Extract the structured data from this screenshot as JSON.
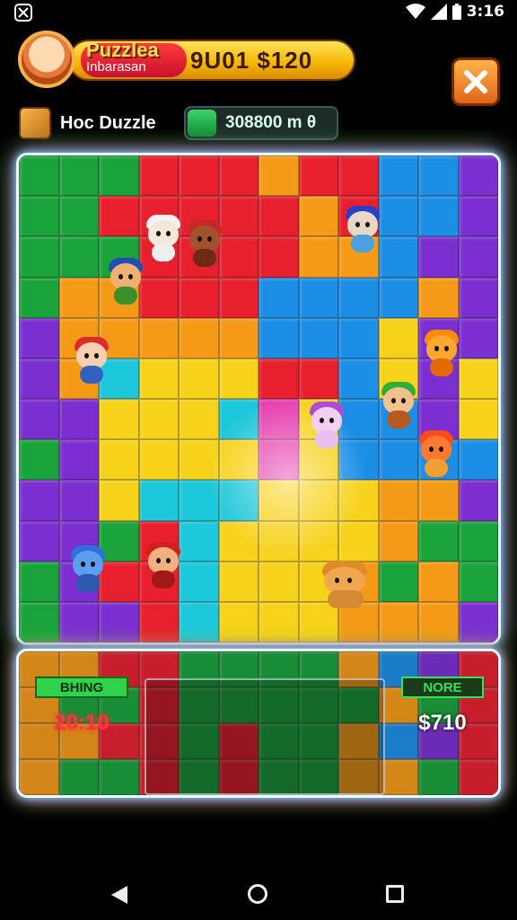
{
  "status_bar": {
    "time": "3:16",
    "icons": [
      "app-notification-icon",
      "wifi-icon",
      "signal-icon",
      "battery-icon"
    ]
  },
  "header": {
    "title": "Puzzlea",
    "subtitle": "Inbarasan",
    "score": "9U01 $120"
  },
  "sub_header": {
    "puzzle_name": "Hoc Duzzle",
    "coins": "308800 m θ"
  },
  "tray": {
    "left_label": "BHING",
    "timer": "20:10",
    "right_label": "NORE",
    "money": "$710"
  },
  "colors": {
    "board_palette": [
      "#1aa33a",
      "#e81f2d",
      "#f59a16",
      "#1c8ee6",
      "#7b2fd0",
      "#f7d21a",
      "#1cc7d9",
      "#e63fae"
    ],
    "neon_border": "#eafcff",
    "timer_red": "#ff3344",
    "label_green": "#2fd44a"
  },
  "nav_bar": {
    "buttons": [
      "back-icon",
      "home-icon",
      "recent-apps-icon"
    ]
  }
}
